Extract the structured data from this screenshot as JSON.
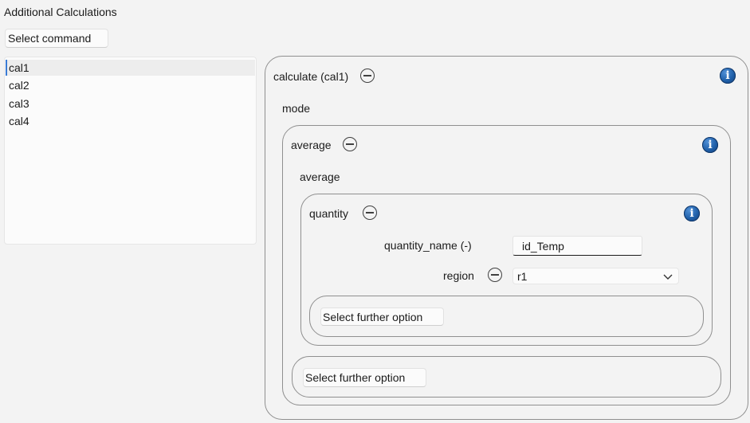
{
  "header": {
    "title": "Additional Calculations"
  },
  "toolbar": {
    "select_command_label": "Select command"
  },
  "list": {
    "items": [
      "cal1",
      "cal2",
      "cal3",
      "cal4"
    ],
    "selected_index": 0
  },
  "calculate_panel": {
    "label": "calculate (cal1)",
    "mode_label": "mode",
    "average_panel": {
      "label": "average",
      "sub_label": "average",
      "quantity_panel": {
        "label": "quantity",
        "quantity_name_label": "quantity_name (-)",
        "quantity_name_value": "id_Temp",
        "region_label": "region",
        "region_value": "r1",
        "further_option_label": "Select further option"
      },
      "further_option_label": "Select further option"
    }
  },
  "icons": {
    "info": "info-icon",
    "remove": "minus-circle-icon",
    "dropdown": "chevron-down-icon"
  },
  "colors": {
    "info_blue": "#1f5fa8",
    "selection_accent": "#3a7bd5"
  }
}
